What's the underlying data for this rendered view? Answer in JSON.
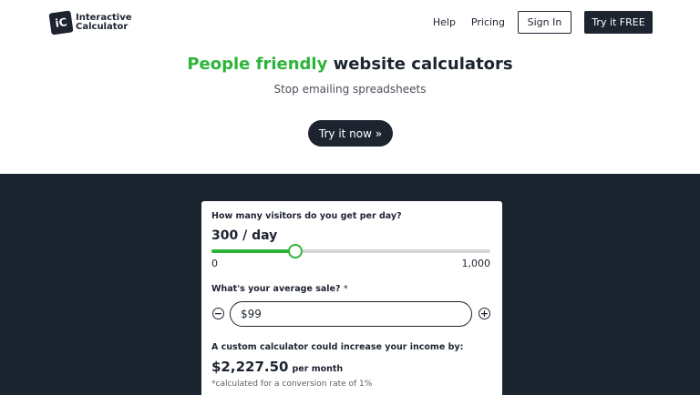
{
  "header": {
    "logo_mark": "iC",
    "logo_line1": "Interactive",
    "logo_line2": "Calculator",
    "nav": {
      "help": "Help",
      "pricing": "Pricing",
      "sign_in": "Sign In",
      "try_free": "Try it FREE"
    }
  },
  "hero": {
    "title_highlight": "People friendly",
    "title_rest": " website calculators",
    "subtitle": "Stop emailing spreadsheets",
    "cta": "Try it now »"
  },
  "calculator": {
    "visitors_question": "How many visitors do you get per day?",
    "visitors_value": "300 / day",
    "slider": {
      "min_label": "0",
      "max_label": "1,000",
      "value": 300,
      "min": 0,
      "max": 1000
    },
    "sale_question": "What's your average sale?",
    "sale_marker": "*",
    "sale_value": "$99",
    "minus_symbol": "−",
    "plus_symbol": "+",
    "result_label": "A custom calculator could increase your income by:",
    "result_amount": "$2,227.50",
    "result_unit": "per month",
    "footnote": "*calculated for a conversion rate of 1%"
  },
  "colors": {
    "brand_dark": "#1d2430",
    "accent_green": "#2cb53a"
  }
}
